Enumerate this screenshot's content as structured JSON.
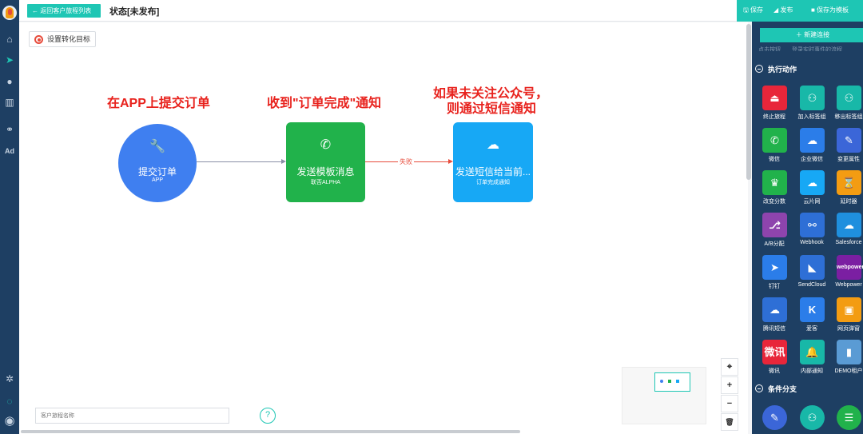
{
  "topbar": {
    "back_label": "← 返回客户旅程列表",
    "page_title": "状态[未发布]",
    "save_label": "🖫 保存",
    "publish_label": "◢ 发布",
    "template_label": "■ 保存为模板"
  },
  "canvas": {
    "goal_label": "设置转化目标",
    "step_titles": [
      "在APP上提交订单",
      "收到\"订单完成\"通知",
      "如果未关注公众号，",
      "则通过短信通知"
    ],
    "nodes": [
      {
        "name": "提交订单",
        "sub": "APP",
        "icon": "wrench-icon",
        "color": "#3f7ff0"
      },
      {
        "name": "发送模板消息",
        "sub": "联否ALPHA",
        "icon": "wechat-icon",
        "color": "#21b24b"
      },
      {
        "name": "发送短信给当前...",
        "sub": "订单完成通知",
        "icon": "cloud-icon",
        "color": "#17a8f5"
      }
    ],
    "edge_label": "失败",
    "name_placeholder": "客户旅程名称",
    "help_label": "?"
  },
  "zoom": {
    "fit": "⌖",
    "plus": "+",
    "minus": "−",
    "trash": "🗑"
  },
  "rpanel": {
    "new_conn": "＋ 新建连接",
    "cut_text": "点击按钮　　登录实时事件的流程",
    "section_actions": "执行动作",
    "section_branch": "条件分支",
    "tools": [
      {
        "label": "终止旅程",
        "glyph": "⏏",
        "color": "#e8263a"
      },
      {
        "label": "加入标签组",
        "glyph": "⚇",
        "color": "#18b8a8"
      },
      {
        "label": "移出标签组",
        "glyph": "⚇",
        "color": "#18b8a8"
      },
      {
        "label": "微信",
        "glyph": "✆",
        "color": "#21b24b"
      },
      {
        "label": "企业微信",
        "glyph": "☁",
        "color": "#2b7de9"
      },
      {
        "label": "变更属性",
        "glyph": "✎",
        "color": "#3b66d8"
      },
      {
        "label": "改变分数",
        "glyph": "♛",
        "color": "#21b24b"
      },
      {
        "label": "云片网",
        "glyph": "☁",
        "color": "#17a8f5"
      },
      {
        "label": "延时器",
        "glyph": "⌛",
        "color": "#f39c12"
      },
      {
        "label": "A/B分配",
        "glyph": "⎇",
        "color": "#8e44ad"
      },
      {
        "label": "Webhook",
        "glyph": "⚯",
        "color": "#2e6fd6"
      },
      {
        "label": "Salesforce",
        "glyph": "☁",
        "color": "#1f8fde"
      },
      {
        "label": "钉钉",
        "glyph": "➤",
        "color": "#2b7de9"
      },
      {
        "label": "SendCloud",
        "glyph": "◣",
        "color": "#2e6fd6"
      },
      {
        "label": "Webpower",
        "glyph": "webpower",
        "color": "#7b1fa2"
      },
      {
        "label": "腾讯短信",
        "glyph": "☁",
        "color": "#2e6fd6"
      },
      {
        "label": "爱客",
        "glyph": "K",
        "color": "#2b7de9"
      },
      {
        "label": "网页弹窗",
        "glyph": "▣",
        "color": "#f39c12"
      },
      {
        "label": "微讯",
        "glyph": "微讯",
        "color": "#e8263a"
      },
      {
        "label": "内部通知",
        "glyph": "🔔",
        "color": "#18b8a8"
      },
      {
        "label": "DEMO租户",
        "glyph": "▮",
        "color": "#5a9bd4"
      }
    ],
    "branch_tools": [
      {
        "glyph": "✎",
        "color": "#3b66d8"
      },
      {
        "glyph": "⚇",
        "color": "#18b8a8"
      },
      {
        "glyph": "☰",
        "color": "#21b24b"
      }
    ]
  }
}
